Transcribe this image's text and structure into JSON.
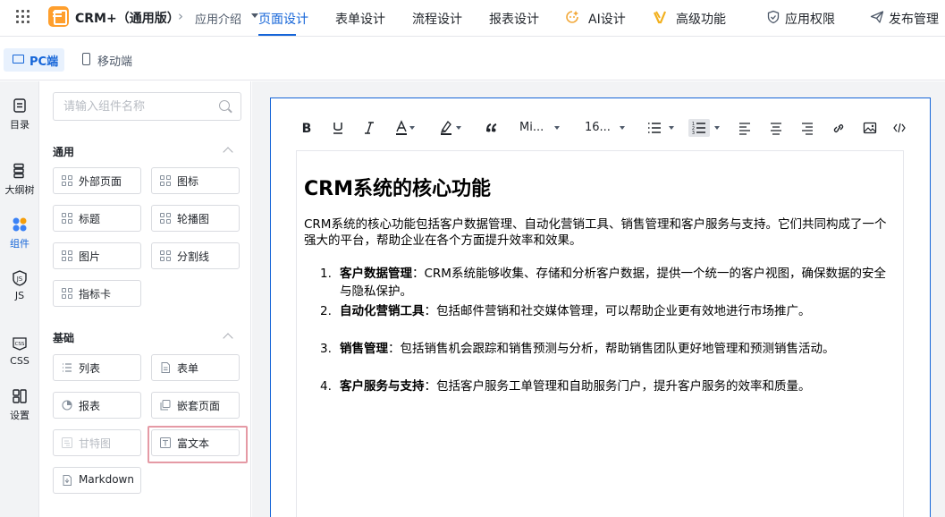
{
  "app": {
    "name": "CRM+（通用版）",
    "breadcrumb": "应用介绍",
    "brand_color": "#1565d8",
    "logo_color": "#ff9f2d"
  },
  "nav": {
    "tabs": [
      {
        "label": "页面设计",
        "active": true,
        "icon": null
      },
      {
        "label": "表单设计",
        "active": false,
        "icon": null
      },
      {
        "label": "流程设计",
        "active": false,
        "icon": null
      },
      {
        "label": "报表设计",
        "active": false,
        "icon": null
      },
      {
        "label": "AI设计",
        "active": false,
        "icon": "ai-icon"
      },
      {
        "label": "高级功能",
        "active": false,
        "icon": "advanced-icon"
      },
      {
        "label": "应用权限",
        "active": false,
        "icon": "shield-icon"
      },
      {
        "label": "发布管理",
        "active": false,
        "icon": "publish-icon"
      }
    ]
  },
  "device": {
    "pc_label": "PC端",
    "mobile_label": "移动端",
    "selected": "PC端"
  },
  "rail": {
    "items": [
      {
        "label": "目录",
        "icon": "catalog-icon",
        "active": false
      },
      {
        "label": "大纲树",
        "icon": "outline-tree-icon",
        "active": false
      },
      {
        "label": "组件",
        "icon": "components-icon",
        "active": true
      },
      {
        "label": "JS",
        "icon": "js-icon",
        "active": false
      },
      {
        "label": "CSS",
        "icon": "css-icon",
        "active": false
      },
      {
        "label": "设置",
        "icon": "settings-icon",
        "active": false
      }
    ]
  },
  "panel": {
    "search_placeholder": "请输入组件名称",
    "groups": [
      {
        "title": "通用",
        "items": [
          {
            "label": "外部页面",
            "icon": "grid-icon"
          },
          {
            "label": "图标",
            "icon": "grid-icon"
          },
          {
            "label": "标题",
            "icon": "grid-icon"
          },
          {
            "label": "轮播图",
            "icon": "grid-icon"
          },
          {
            "label": "图片",
            "icon": "grid-icon"
          },
          {
            "label": "分割线",
            "icon": "grid-icon"
          },
          {
            "label": "指标卡",
            "icon": "grid-icon"
          }
        ]
      },
      {
        "title": "基础",
        "items": [
          {
            "label": "列表",
            "icon": "list-icon"
          },
          {
            "label": "表单",
            "icon": "form-icon"
          },
          {
            "label": "报表",
            "icon": "report-icon"
          },
          {
            "label": "嵌套页面",
            "icon": "nested-page-icon"
          },
          {
            "label": "甘特图",
            "icon": "gantt-icon",
            "disabled": true
          },
          {
            "label": "富文本",
            "icon": "rich-text-icon",
            "highlighted": true
          },
          {
            "label": "Markdown",
            "icon": "markdown-icon"
          }
        ]
      }
    ]
  },
  "toolbar": {
    "font_family": "Mi...",
    "font_size": "16...",
    "buttons": [
      "bold-icon",
      "underline-icon",
      "italic-icon",
      "font-color-icon",
      "highlight-icon",
      "quote-icon",
      "font-family-select",
      "font-size-select",
      "bullet-list-icon",
      "ordered-list-icon",
      "align-left-icon",
      "align-center-icon",
      "align-right-icon",
      "link-icon",
      "image-icon",
      "code-icon"
    ]
  },
  "document": {
    "heading": "CRM系统的核心功能",
    "intro": "CRM系统的核心功能包括客户数据管理、自动化营销工具、销售管理和客户服务与支持。它们共同构成了一个强大的平台，帮助企业在各个方面提升效率和效果。",
    "list": [
      {
        "num": "1.",
        "title": "客户数据管理",
        "text": "：CRM系统能够收集、存储和分析客户数据，提供一个统一的客户视图，确保数据的安全与隐私保护。"
      },
      {
        "num": "2.",
        "title": "自动化营销工具",
        "text": "：包括邮件营销和社交媒体管理，可以帮助企业更有效地进行市场推广。"
      },
      {
        "num": "3.",
        "title": "销售管理",
        "text": "：包括销售机会跟踪和销售预测与分析，帮助销售团队更好地管理和预测销售活动。"
      },
      {
        "num": "4.",
        "title": "客户服务与支持",
        "text": "：包括客户服务工单管理和自助服务门户，提升客户服务的效率和质量。"
      }
    ]
  }
}
